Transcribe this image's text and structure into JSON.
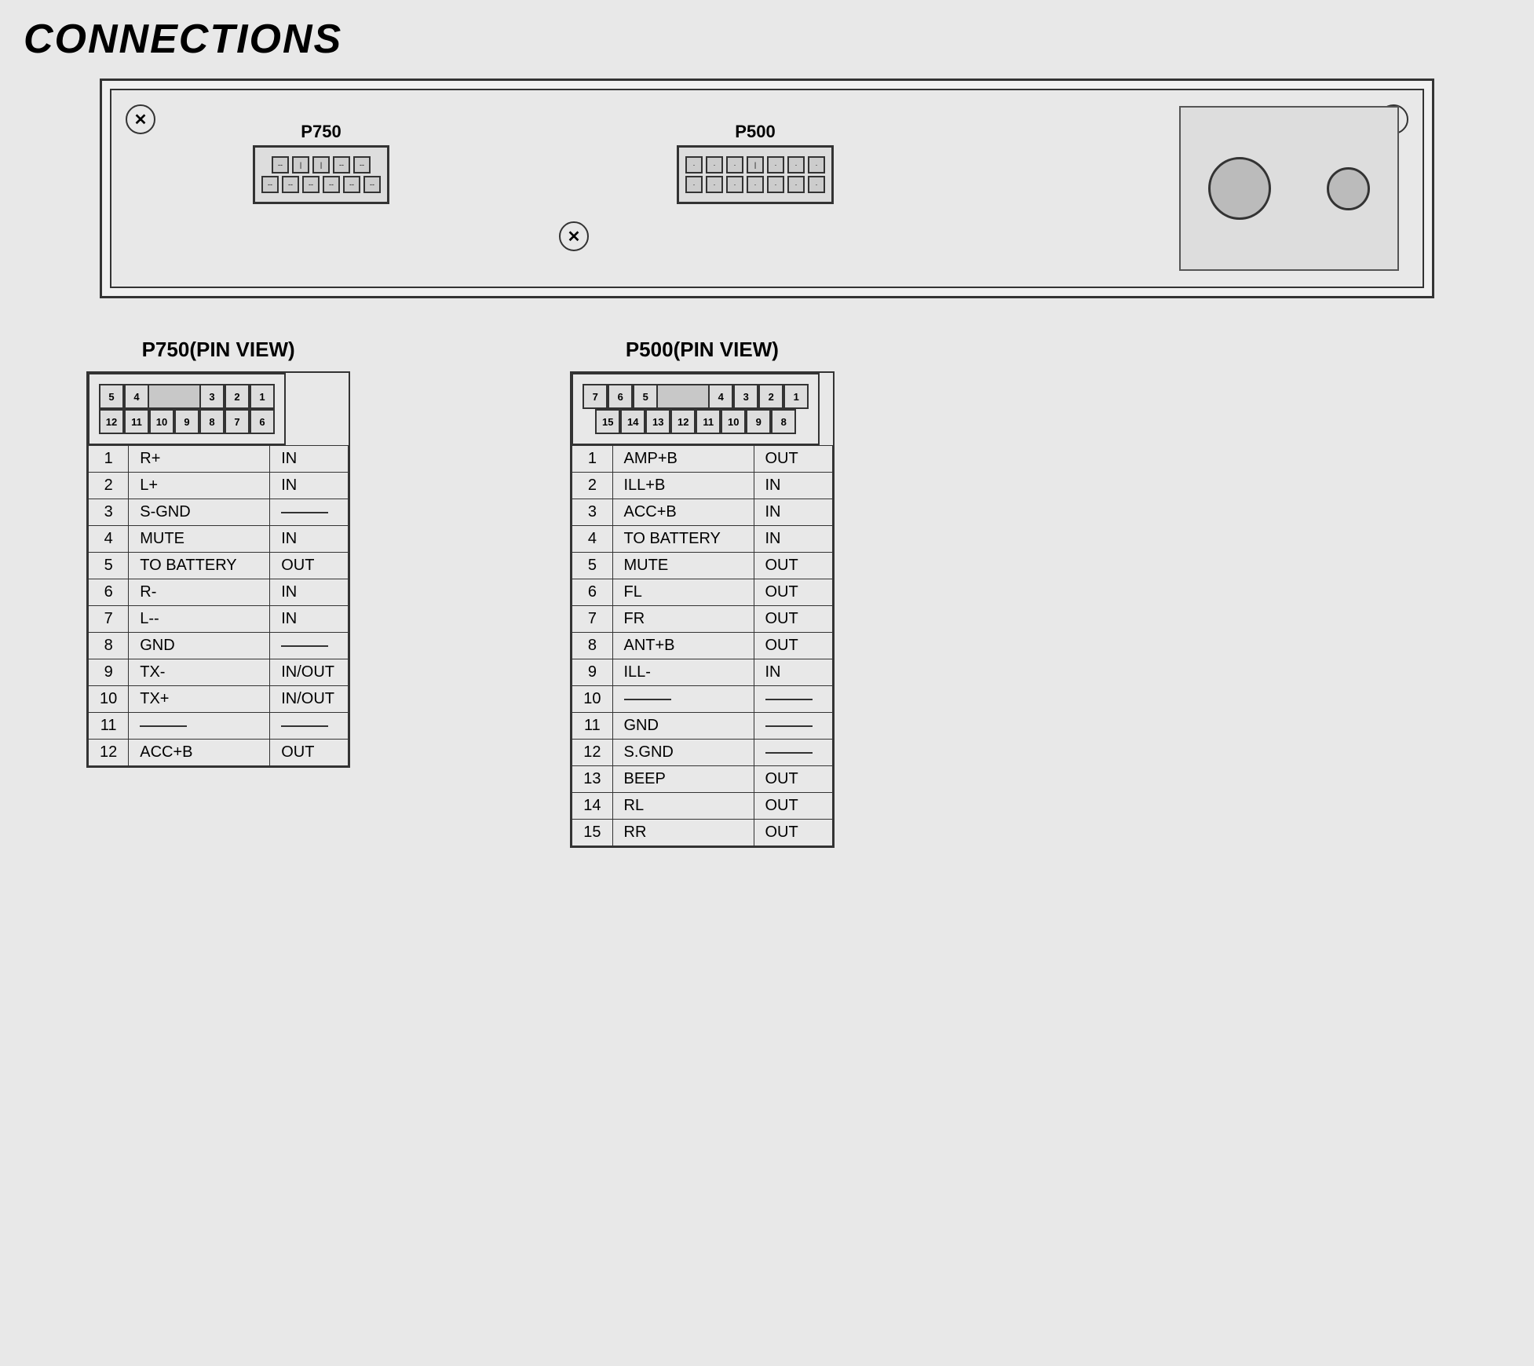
{
  "title": "CONNECTIONS",
  "device": {
    "connector_p750_label": "P750",
    "connector_p500_label": "P500"
  },
  "p750_pin_view": {
    "title": "P750(PIN VIEW)",
    "top_row": [
      "5",
      "4",
      "",
      "3",
      "2",
      "1"
    ],
    "bottom_row": [
      "12",
      "11",
      "10",
      "9",
      "8",
      "7",
      "6"
    ],
    "pins": [
      {
        "num": "1",
        "name": "R+",
        "dir": "IN"
      },
      {
        "num": "2",
        "name": "L+",
        "dir": "IN"
      },
      {
        "num": "3",
        "name": "S-GND",
        "dir": "—"
      },
      {
        "num": "4",
        "name": "MUTE",
        "dir": "IN"
      },
      {
        "num": "5",
        "name": "TO BATTERY",
        "dir": "OUT"
      },
      {
        "num": "6",
        "name": "R-",
        "dir": "IN"
      },
      {
        "num": "7",
        "name": "L--",
        "dir": "IN"
      },
      {
        "num": "8",
        "name": "GND",
        "dir": "—"
      },
      {
        "num": "9",
        "name": "TX-",
        "dir": "IN/OUT"
      },
      {
        "num": "10",
        "name": "TX+",
        "dir": "IN/OUT"
      },
      {
        "num": "11",
        "name": "—",
        "dir": "—"
      },
      {
        "num": "12",
        "name": "ACC+B",
        "dir": "OUT"
      }
    ]
  },
  "p500_pin_view": {
    "title": "P500(PIN VIEW)",
    "top_row": [
      "7",
      "6",
      "5",
      "",
      "4",
      "3",
      "2",
      "1"
    ],
    "bottom_row": [
      "15",
      "14",
      "13",
      "12",
      "11",
      "10",
      "9",
      "8"
    ],
    "pins": [
      {
        "num": "1",
        "name": "AMP+B",
        "dir": "OUT"
      },
      {
        "num": "2",
        "name": "ILL+B",
        "dir": "IN"
      },
      {
        "num": "3",
        "name": "ACC+B",
        "dir": "IN"
      },
      {
        "num": "4",
        "name": "TO BATTERY",
        "dir": "IN"
      },
      {
        "num": "5",
        "name": "MUTE",
        "dir": "OUT"
      },
      {
        "num": "6",
        "name": "FL",
        "dir": "OUT"
      },
      {
        "num": "7",
        "name": "FR",
        "dir": "OUT"
      },
      {
        "num": "8",
        "name": "ANT+B",
        "dir": "OUT"
      },
      {
        "num": "9",
        "name": "ILL-",
        "dir": "IN"
      },
      {
        "num": "10",
        "name": "—",
        "dir": "—"
      },
      {
        "num": "11",
        "name": "GND",
        "dir": "—"
      },
      {
        "num": "12",
        "name": "S.GND",
        "dir": "—"
      },
      {
        "num": "13",
        "name": "BEEP",
        "dir": "OUT"
      },
      {
        "num": "14",
        "name": "RL",
        "dir": "OUT"
      },
      {
        "num": "15",
        "name": "RR",
        "dir": "OUT"
      }
    ]
  }
}
